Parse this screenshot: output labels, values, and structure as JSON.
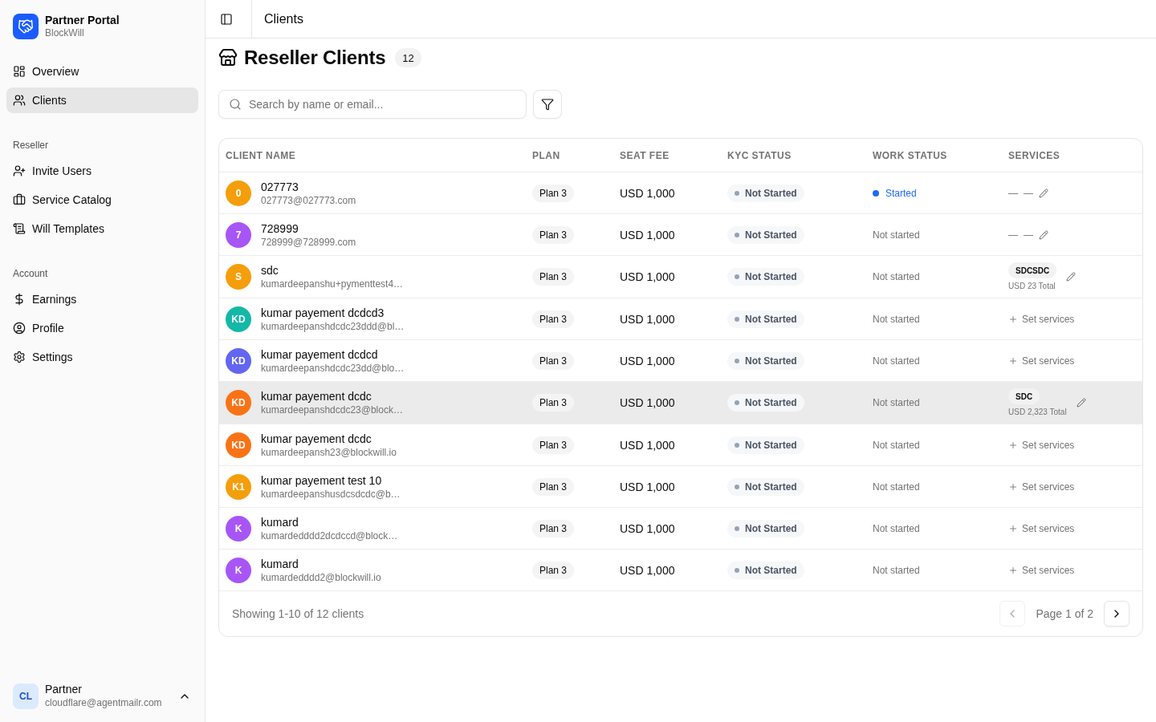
{
  "sidebar": {
    "brand": {
      "title": "Partner Portal",
      "subtitle": "BlockWill"
    },
    "sections": [
      {
        "items": [
          {
            "label": "Overview",
            "selected": false
          },
          {
            "label": "Clients",
            "selected": true
          }
        ]
      },
      {
        "label": "Reseller",
        "items": [
          {
            "label": "Invite Users",
            "selected": false
          },
          {
            "label": "Service Catalog",
            "selected": false
          },
          {
            "label": "Will Templates",
            "selected": false
          }
        ]
      },
      {
        "label": "Account",
        "items": [
          {
            "label": "Earnings",
            "selected": false
          },
          {
            "label": "Profile",
            "selected": false
          },
          {
            "label": "Settings",
            "selected": false
          }
        ]
      }
    ],
    "user": {
      "initials": "CL",
      "name": "Partner",
      "email": "cloudflare@agentmailr.com"
    }
  },
  "topbar": {
    "title": "Clients"
  },
  "page": {
    "title": "Reseller Clients",
    "count": "12"
  },
  "search": {
    "placeholder": "Search by name or email..."
  },
  "table": {
    "columns": [
      "CLIENT NAME",
      "PLAN",
      "SEAT FEE",
      "KYC STATUS",
      "WORK STATUS",
      "SERVICES"
    ],
    "rows": [
      {
        "initials": "0",
        "color": "#f59e0b",
        "name": "027773",
        "email": "027773@027773.com",
        "plan": "Plan 3",
        "seat_fee": "USD 1,000",
        "kyc": "Not Started",
        "work_status": {
          "kind": "started",
          "label": "Started"
        },
        "services": {
          "kind": "empty",
          "placeholders": [
            "—",
            "—"
          ]
        },
        "highlighted": false
      },
      {
        "initials": "7",
        "color": "#a855f7",
        "name": "728999",
        "email": "728999@728999.com",
        "plan": "Plan 3",
        "seat_fee": "USD 1,000",
        "kyc": "Not Started",
        "work_status": {
          "kind": "not_started",
          "label": "Not started"
        },
        "services": {
          "kind": "empty",
          "placeholders": [
            "—",
            "—"
          ]
        },
        "highlighted": false
      },
      {
        "initials": "S",
        "color": "#f59e0b",
        "name": "sdc",
        "email": "kumardeepanshu+pymenttest4…",
        "plan": "Plan 3",
        "seat_fee": "USD 1,000",
        "kyc": "Not Started",
        "work_status": {
          "kind": "not_started",
          "label": "Not started"
        },
        "services": {
          "kind": "assigned",
          "tags": [
            "SDCSDC"
          ],
          "total": "USD 23 Total"
        },
        "highlighted": false
      },
      {
        "initials": "KD",
        "color": "#14b8a6",
        "name": "kumar payement dcdcd3",
        "email": "kumardeepanshdcdc23ddd@bl…",
        "plan": "Plan 3",
        "seat_fee": "USD 1,000",
        "kyc": "Not Started",
        "work_status": {
          "kind": "not_started",
          "label": "Not started"
        },
        "services": {
          "kind": "unset",
          "label": "Set services"
        },
        "highlighted": false
      },
      {
        "initials": "KD",
        "color": "#6366f1",
        "name": "kumar payement dcdcd",
        "email": "kumardeepanshdcdc23dd@blo…",
        "plan": "Plan 3",
        "seat_fee": "USD 1,000",
        "kyc": "Not Started",
        "work_status": {
          "kind": "not_started",
          "label": "Not started"
        },
        "services": {
          "kind": "unset",
          "label": "Set services"
        },
        "highlighted": false
      },
      {
        "initials": "KD",
        "color": "#f97316",
        "name": "kumar payement dcdc",
        "email": "kumardeepanshdcdc23@block…",
        "plan": "Plan 3",
        "seat_fee": "USD 1,000",
        "kyc": "Not Started",
        "work_status": {
          "kind": "not_started",
          "label": "Not started"
        },
        "services": {
          "kind": "assigned",
          "tags": [
            "SDC"
          ],
          "total": "USD 2,323 Total"
        },
        "highlighted": true
      },
      {
        "initials": "KD",
        "color": "#f97316",
        "name": "kumar payement dcdc",
        "email": "kumardeepansh23@blockwill.io",
        "plan": "Plan 3",
        "seat_fee": "USD 1,000",
        "kyc": "Not Started",
        "work_status": {
          "kind": "not_started",
          "label": "Not started"
        },
        "services": {
          "kind": "unset",
          "label": "Set services"
        },
        "highlighted": false
      },
      {
        "initials": "K1",
        "color": "#f59e0b",
        "name": "kumar payement test 10",
        "email": "kumardeepanshusdcsdcdc@b…",
        "plan": "Plan 3",
        "seat_fee": "USD 1,000",
        "kyc": "Not Started",
        "work_status": {
          "kind": "not_started",
          "label": "Not started"
        },
        "services": {
          "kind": "unset",
          "label": "Set services"
        },
        "highlighted": false
      },
      {
        "initials": "K",
        "color": "#a855f7",
        "name": "kumard",
        "email": "kumardedddd2dcdccd@block…",
        "plan": "Plan 3",
        "seat_fee": "USD 1,000",
        "kyc": "Not Started",
        "work_status": {
          "kind": "not_started",
          "label": "Not started"
        },
        "services": {
          "kind": "unset",
          "label": "Set services"
        },
        "highlighted": false
      },
      {
        "initials": "K",
        "color": "#a855f7",
        "name": "kumard",
        "email": "kumardedddd2@blockwill.io",
        "plan": "Plan 3",
        "seat_fee": "USD 1,000",
        "kyc": "Not Started",
        "work_status": {
          "kind": "not_started",
          "label": "Not started"
        },
        "services": {
          "kind": "unset",
          "label": "Set services"
        },
        "highlighted": false
      }
    ]
  },
  "pagination": {
    "summary": "Showing 1-10 of 12 clients",
    "page_label": "Page 1 of 2",
    "previous": {
      "disabled": true
    },
    "next": {
      "disabled": false
    }
  }
}
